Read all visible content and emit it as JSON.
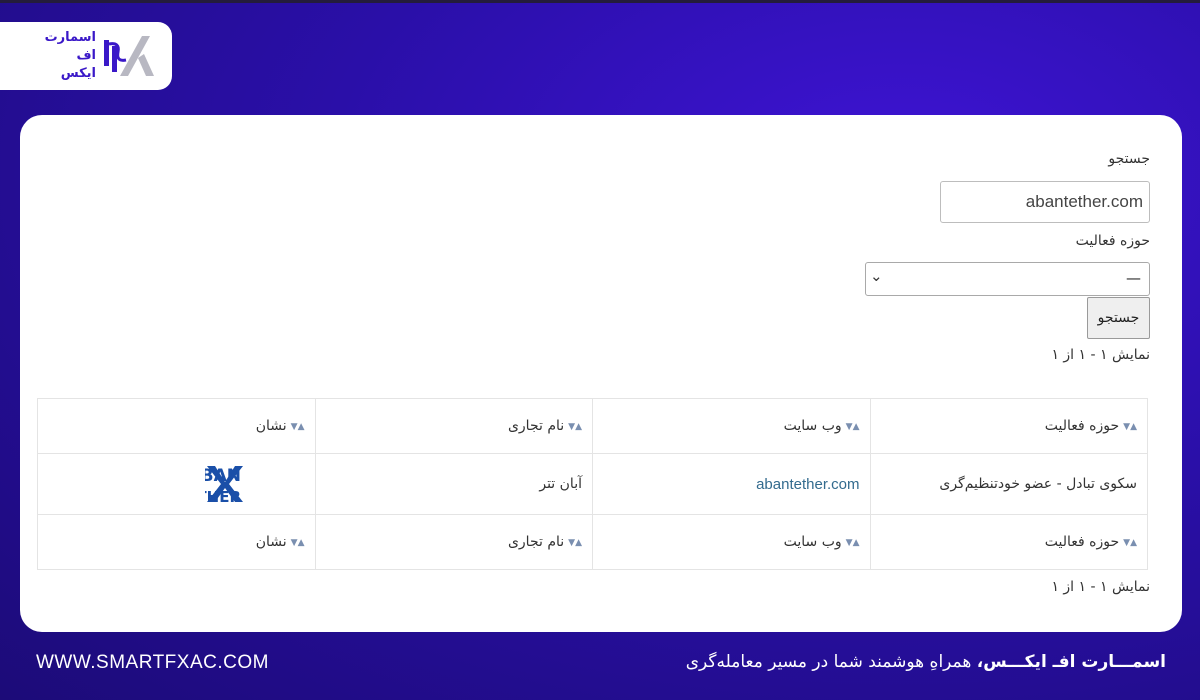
{
  "logo": {
    "lines": [
      "اسمارت",
      "اف",
      "ایکس"
    ]
  },
  "search": {
    "label": "جستجو",
    "value": "abantether.com"
  },
  "activity_filter": {
    "label": "حوزه فعالیت",
    "selected": "—"
  },
  "search_button": "جستجو",
  "result_count_top": "نمایش ۱ - ۱ از ۱",
  "table": {
    "columns": [
      "حوزه فعالیت",
      "وب سایت",
      "نام تجاری",
      "نشان"
    ],
    "rows": [
      {
        "activity": "سکوی تبادل - عضو خودتنظیم‌گری",
        "website": "abantether.com",
        "brand_name": "آبان تتر",
        "logo_lines": [
          "ABAN",
          "TETHER"
        ]
      }
    ]
  },
  "result_count_bottom": "نمایش ۱ - ۱ از ۱",
  "footer": {
    "url": "WWW.SMARTFXAC.COM",
    "tagline_brand": "اسمـــارت افـ ایکـــس،",
    "tagline_rest": " همراهِ هوشمند شما در مسیر معامله‌گری"
  },
  "colors": {
    "background": "#2a0fa8",
    "accent": "#3a18c8",
    "link": "#336b8e",
    "aban_blue": "#1a4fa8"
  }
}
